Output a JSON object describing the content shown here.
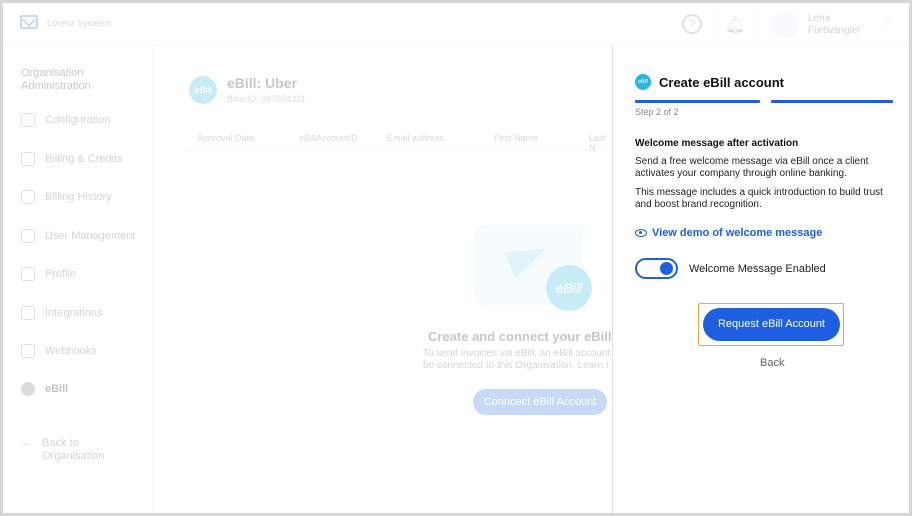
{
  "topbar": {
    "company": "Lorenz Systems",
    "user_name": "Lena Furtwängler",
    "help_icon": "help-circle-icon",
    "bell_icon": "bell-icon"
  },
  "sidebar": {
    "org_title": "Organisation Administration",
    "items": [
      {
        "label": "Configuration",
        "icon": "gear-icon"
      },
      {
        "label": "Billing & Credits",
        "icon": "wallet-icon"
      },
      {
        "label": "Billing History",
        "icon": "document-icon"
      },
      {
        "label": "User Management",
        "icon": "users-icon"
      },
      {
        "label": "Profile",
        "icon": "wand-icon"
      },
      {
        "label": "Integrations",
        "icon": "grid-icon"
      },
      {
        "label": "Webhooks",
        "icon": "webhook-icon"
      },
      {
        "label": "eBill",
        "icon": "ebill-icon"
      }
    ],
    "back_label": "Back to Organisation"
  },
  "main": {
    "badge": "eBill",
    "title": "eBill: Uber",
    "biller_id": "BillerID: 987654321",
    "columns": [
      "Approval Date",
      "eBillAccountID",
      "Email address",
      "First Name",
      "Last N"
    ],
    "empty_badge": "eBill",
    "empty_title": "Create and connect your eBill acco",
    "empty_text": "To send invoices via eBill, an eBill account be connected to this Organisation. Learn r",
    "connect_label": "Conncect eBill Account"
  },
  "panel": {
    "badge": "eBill",
    "title": "Create eBill account",
    "step_label": "Step 2 of 2",
    "section_heading": "Welcome message after activation",
    "paragraph1": "Send a free welcome message via eBill once a client activates your company through online banking.",
    "paragraph2": "This message includes a quick introduction to build trust and boost brand recognition.",
    "demo_link": "View demo of welcome message",
    "toggle_label": "Welcome Message Enabled",
    "toggle_on": true,
    "request_label": "Request eBill Account",
    "back_label": "Back",
    "accent": "#1d5fe0",
    "highlight": "#f2a73b"
  }
}
